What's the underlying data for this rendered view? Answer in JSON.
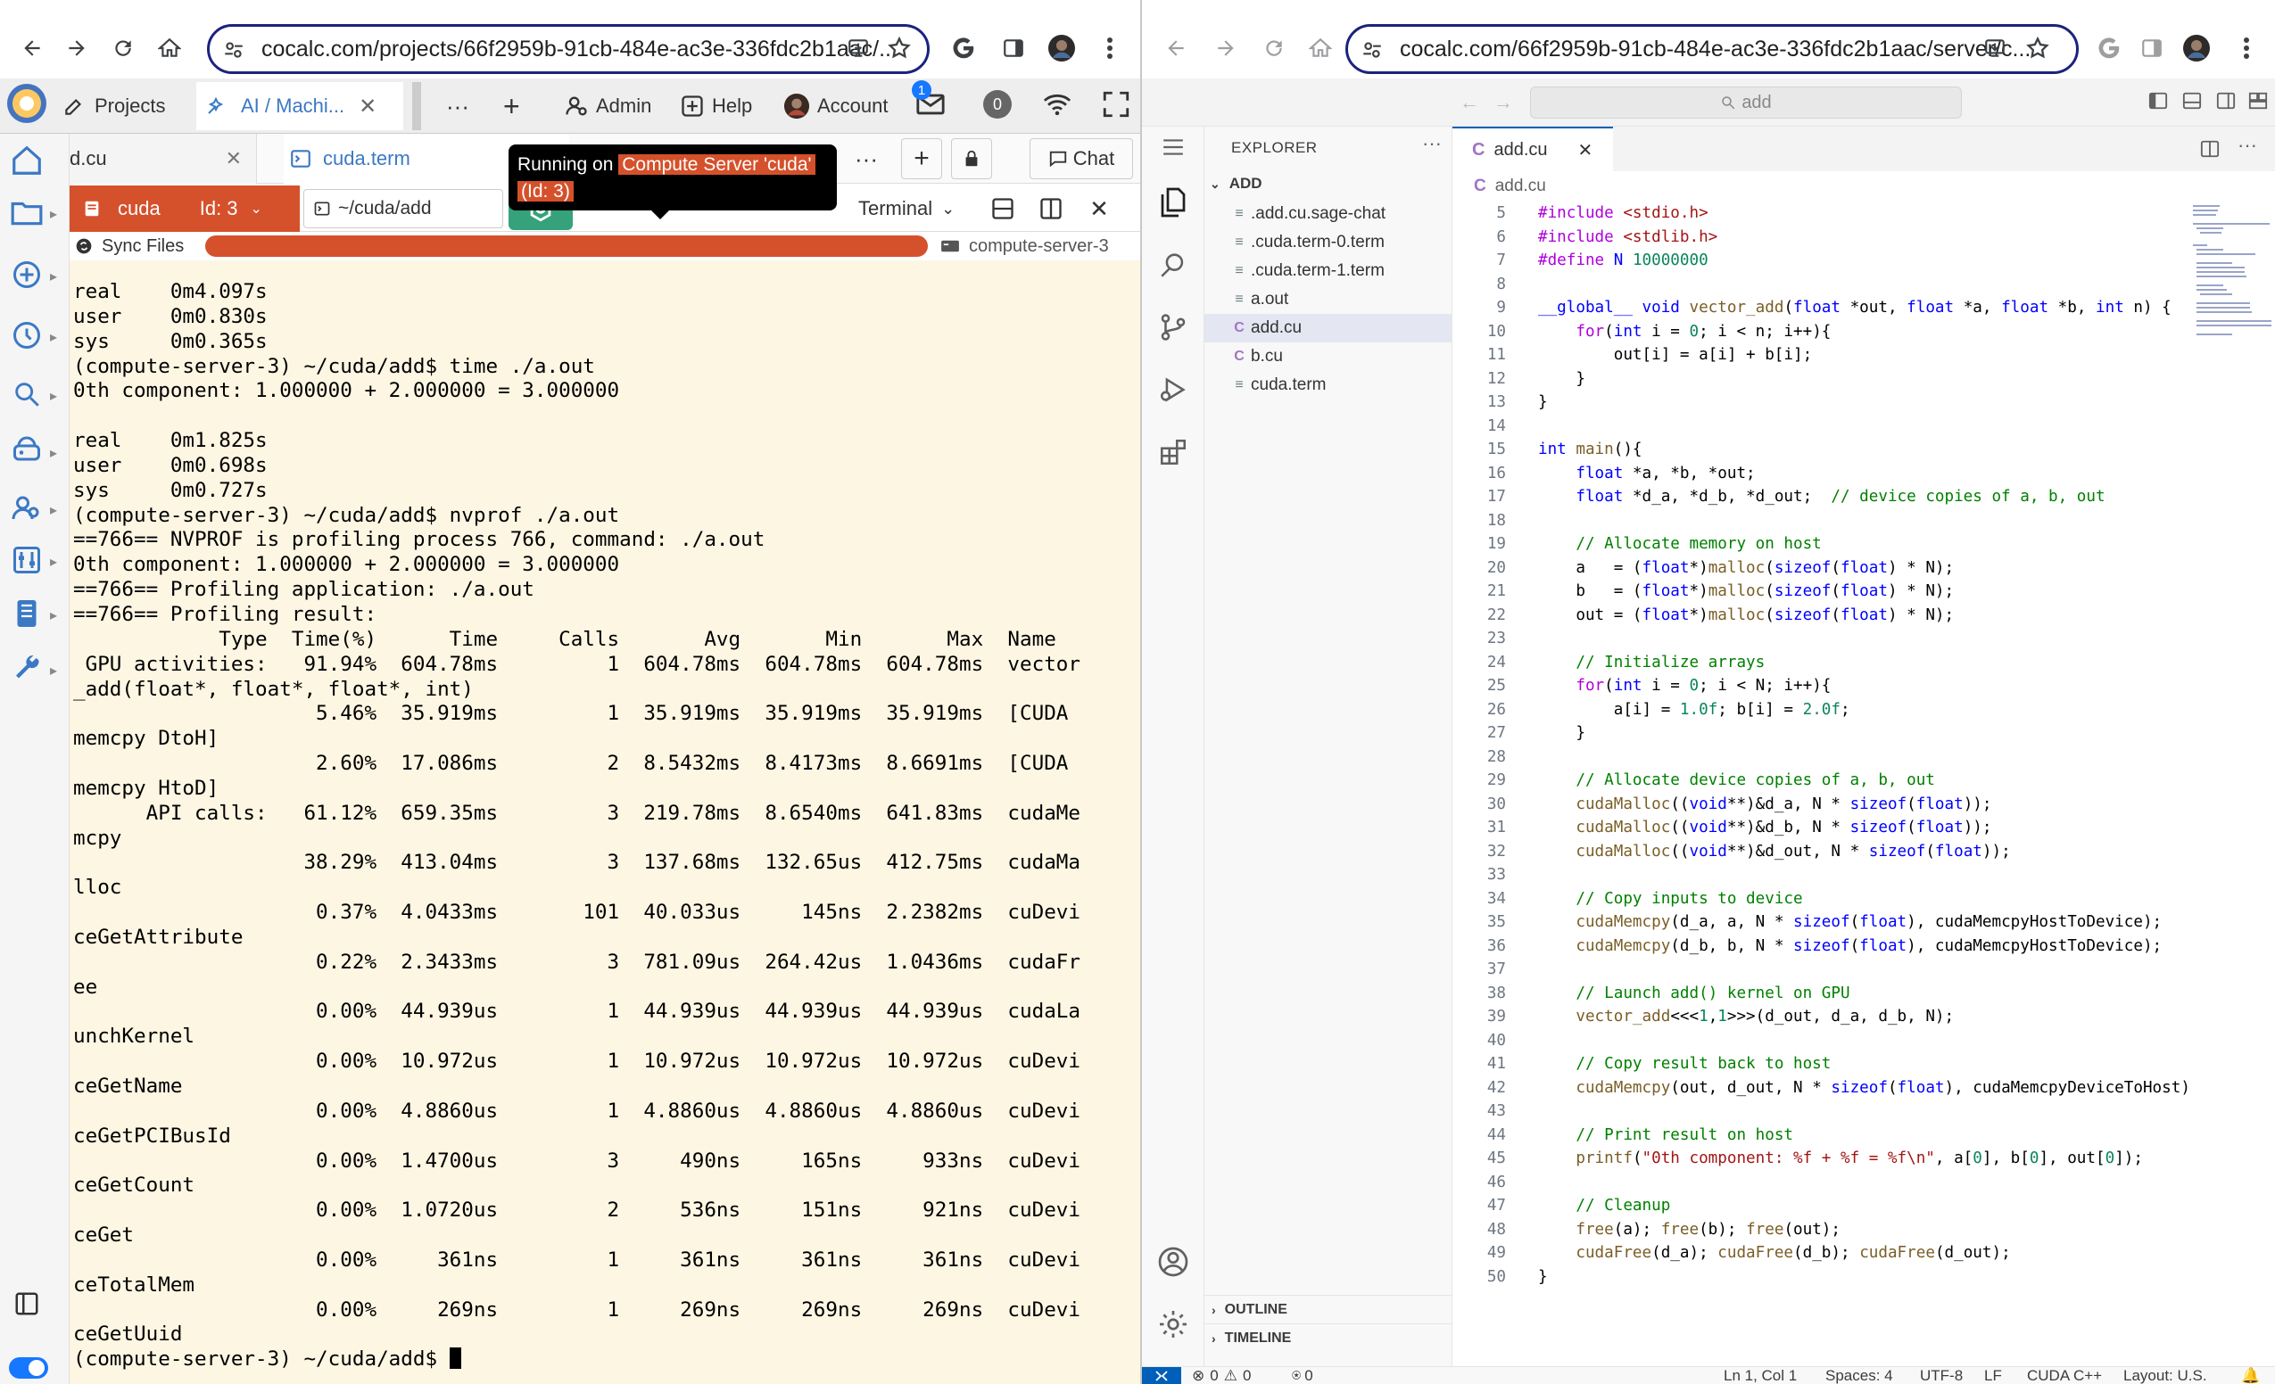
{
  "left_browser": {
    "url": "cocalc.com/projects/66f2959b-91cb-484e-ac3e-336fdc2b1aac/...",
    "cocalc": {
      "projects_label": "Projects",
      "project_tab_label": "AI / Machi...",
      "more_label": "···",
      "admin_label": "Admin",
      "help_label": "Help",
      "account_label": "Account",
      "notification_count": "1",
      "news_count": "0"
    },
    "file_tabs": [
      {
        "label": "d.cu"
      },
      {
        "label": "cuda.term"
      }
    ],
    "chat_label": "Chat",
    "frame": {
      "server_name": "cuda",
      "server_id": "Id: 3",
      "path": "~/cuda/add",
      "terminal_label": "Terminal"
    },
    "sync_label": "Sync Files",
    "server_label": "compute-server-3",
    "tooltip": {
      "prefix": "Running on",
      "highlight": "Compute Server 'cuda'",
      "id": "(Id: 3)"
    },
    "terminal_lines": [
      "real    0m4.097s",
      "user    0m0.830s",
      "sys     0m0.365s",
      "(compute-server-3) ~/cuda/add$ time ./a.out",
      "0th component: 1.000000 + 2.000000 = 3.000000",
      "",
      "real    0m1.825s",
      "user    0m0.698s",
      "sys     0m0.727s",
      "(compute-server-3) ~/cuda/add$ nvprof ./a.out",
      "==766== NVPROF is profiling process 766, command: ./a.out",
      "0th component: 1.000000 + 2.000000 = 3.000000",
      "==766== Profiling application: ./a.out",
      "==766== Profiling result:",
      "            Type  Time(%)      Time     Calls       Avg       Min       Max  Name",
      " GPU activities:   91.94%  604.78ms         1  604.78ms  604.78ms  604.78ms  vector",
      "_add(float*, float*, float*, int)",
      "                    5.46%  35.919ms         1  35.919ms  35.919ms  35.919ms  [CUDA",
      "memcpy DtoH]",
      "                    2.60%  17.086ms         2  8.5432ms  8.4173ms  8.6691ms  [CUDA",
      "memcpy HtoD]",
      "      API calls:   61.12%  659.35ms         3  219.78ms  8.6540ms  641.83ms  cudaMe",
      "mcpy",
      "                   38.29%  413.04ms         3  137.68ms  132.65us  412.75ms  cudaMa",
      "lloc",
      "                    0.37%  4.0433ms       101  40.033us     145ns  2.2382ms  cuDevi",
      "ceGetAttribute",
      "                    0.22%  2.3433ms         3  781.09us  264.42us  1.0436ms  cudaFr",
      "ee",
      "                    0.00%  44.939us         1  44.939us  44.939us  44.939us  cudaLa",
      "unchKernel",
      "                    0.00%  10.972us         1  10.972us  10.972us  10.972us  cuDevi",
      "ceGetName",
      "                    0.00%  4.8860us         1  4.8860us  4.8860us  4.8860us  cuDevi",
      "ceGetPCIBusId",
      "                    0.00%  1.4700us         3     490ns     165ns     933ns  cuDevi",
      "ceGetCount",
      "                    0.00%  1.0720us         2     536ns     151ns     921ns  cuDevi",
      "ceGet",
      "                    0.00%     361ns         1     361ns     361ns     361ns  cuDevi",
      "ceTotalMem",
      "                    0.00%     269ns         1     269ns     269ns     269ns  cuDevi",
      "ceGetUuid"
    ],
    "prompt": "(compute-server-3) ~/cuda/add$ "
  },
  "right_browser": {
    "url": "cocalc.com/66f2959b-91cb-484e-ac3e-336fdc2b1aac/server/c...",
    "search_placeholder": "add",
    "explorer": {
      "title": "EXPLORER",
      "folder": "ADD",
      "files": [
        ".add.cu.sage-chat",
        ".cuda.term-0.term",
        ".cuda.term-1.term",
        "a.out",
        "add.cu",
        "b.cu",
        "cuda.term"
      ],
      "outline": "OUTLINE",
      "timeline": "TIMELINE"
    },
    "editor_tab": "add.cu",
    "breadcrumb": "add.cu",
    "code_start_line": 5,
    "status": {
      "errors": "0",
      "warnings": "0",
      "ports": "0",
      "position": "Ln 1, Col 1",
      "spaces": "Spaces: 4",
      "encoding": "UTF-8",
      "eol": "LF",
      "language": "CUDA C++",
      "layout": "Layout: U.S."
    }
  }
}
